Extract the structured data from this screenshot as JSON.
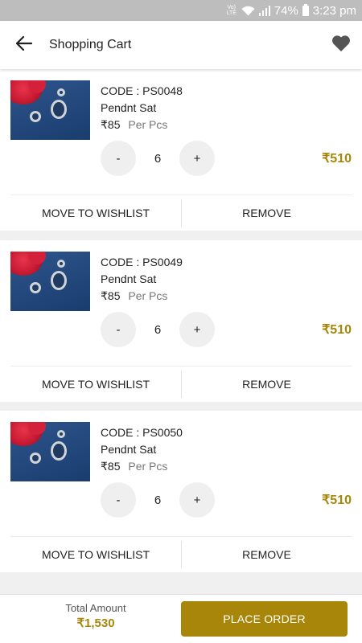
{
  "status_bar": {
    "volte": "Vo) LTE",
    "battery": "74%",
    "time": "3:23 pm"
  },
  "header": {
    "title": "Shopping Cart",
    "back_icon": "arrow-left-icon",
    "wishlist_icon": "heart-icon"
  },
  "cart": {
    "items": [
      {
        "code": "CODE : PS0048",
        "name": "Pendnt Sat",
        "price": "₹85",
        "unit": "Per Pcs",
        "qty_minus": "-",
        "qty": "6",
        "qty_plus": "+",
        "total": "₹510",
        "move_label": "MOVE TO WISHLIST",
        "remove_label": "REMOVE"
      },
      {
        "code": "CODE : PS0049",
        "name": "Pendnt Sat",
        "price": "₹85",
        "unit": "Per Pcs",
        "qty_minus": "-",
        "qty": "6",
        "qty_plus": "+",
        "total": "₹510",
        "move_label": "MOVE TO WISHLIST",
        "remove_label": "REMOVE"
      },
      {
        "code": "CODE : PS0050",
        "name": "Pendnt Sat",
        "price": "₹85",
        "unit": "Per Pcs",
        "qty_minus": "-",
        "qty": "6",
        "qty_plus": "+",
        "total": "₹510",
        "move_label": "MOVE TO WISHLIST",
        "remove_label": "REMOVE"
      }
    ]
  },
  "footer": {
    "total_label": "Total Amount",
    "total_value": "₹1,530",
    "place_order_label": "PLACE ORDER"
  },
  "colors": {
    "accent": "#a8860a",
    "status_bar": "#bdbdbd",
    "background": "#f0f0f0"
  }
}
